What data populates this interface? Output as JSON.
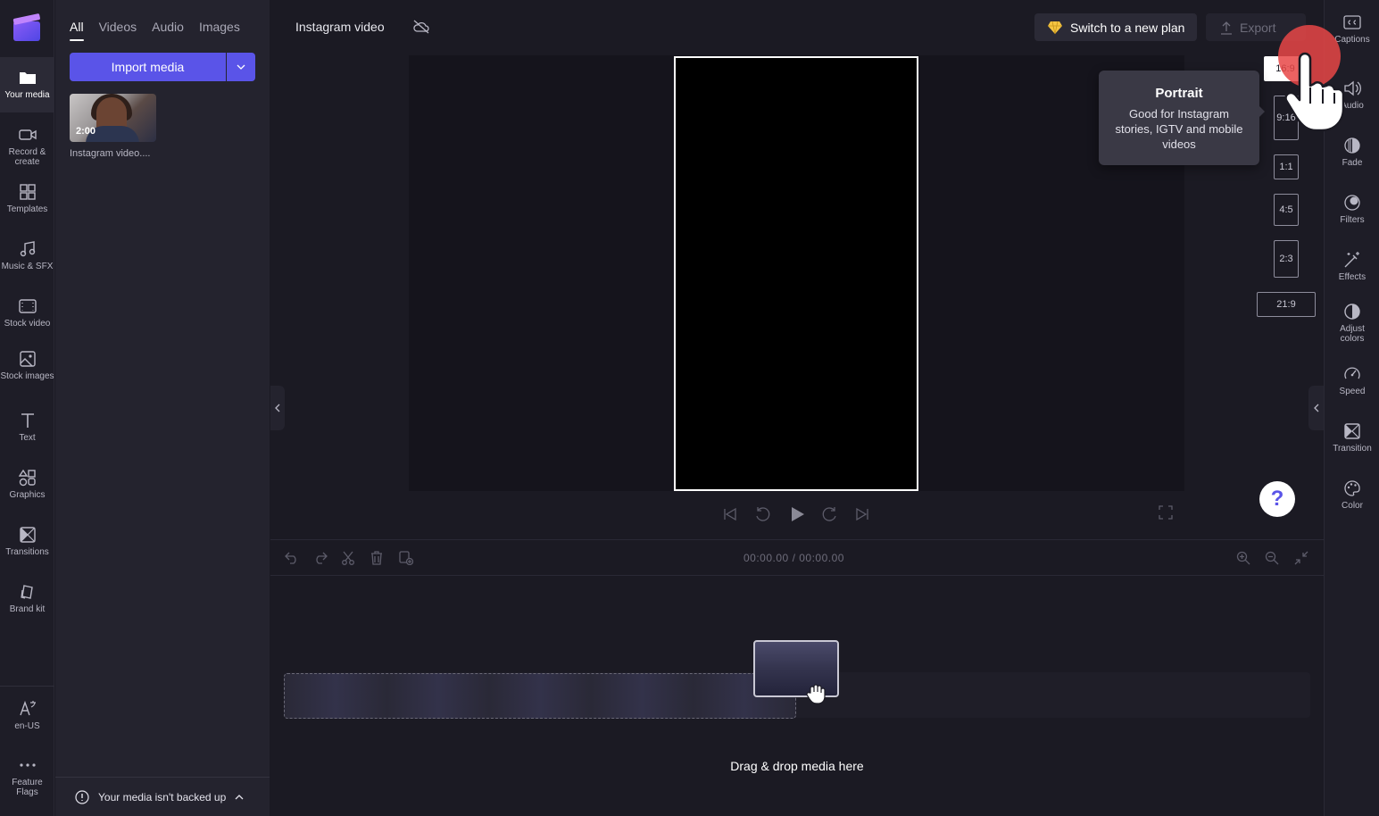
{
  "left_rail": {
    "items": [
      {
        "label": "Your media",
        "icon": "folder-icon"
      },
      {
        "label": "Record & create",
        "icon": "camera-icon"
      },
      {
        "label": "Templates",
        "icon": "templates-icon"
      },
      {
        "label": "Music & SFX",
        "icon": "music-icon"
      },
      {
        "label": "Stock video",
        "icon": "film-icon"
      },
      {
        "label": "Stock images",
        "icon": "image-icon"
      },
      {
        "label": "Text",
        "icon": "text-icon"
      },
      {
        "label": "Graphics",
        "icon": "shapes-icon"
      },
      {
        "label": "Transitions",
        "icon": "transitions-icon"
      },
      {
        "label": "Brand kit",
        "icon": "brand-kit-icon"
      }
    ],
    "language": "en-US",
    "feature_flags": "Feature Flags"
  },
  "media_panel": {
    "tabs": [
      "All",
      "Videos",
      "Audio",
      "Images"
    ],
    "active_tab": "All",
    "import_label": "Import media",
    "item": {
      "duration": "2:00",
      "name": "Instagram video...."
    },
    "backup_notice": "Your media isn't backed up"
  },
  "header": {
    "project_title": "Instagram video",
    "plan_button": "Switch to a new plan",
    "export_button": "Export"
  },
  "aspect_ratios": {
    "options": [
      "16:9",
      "9:16",
      "1:1",
      "4:5",
      "2:3",
      "21:9"
    ],
    "selected": "16:9"
  },
  "tooltip": {
    "title": "Portrait",
    "body": "Good for Instagram stories, IGTV and mobile videos"
  },
  "timeline": {
    "current_time": "00:00.00",
    "separator": "/",
    "total_time": "00:00.00",
    "drop_text": "Drag & drop media here"
  },
  "right_rail": {
    "items": [
      {
        "label": "Captions",
        "icon": "captions-icon"
      },
      {
        "label": "Audio",
        "icon": "speaker-icon"
      },
      {
        "label": "Fade",
        "icon": "fade-icon"
      },
      {
        "label": "Filters",
        "icon": "filters-icon"
      },
      {
        "label": "Effects",
        "icon": "magic-wand-icon"
      },
      {
        "label": "Adjust colors",
        "icon": "contrast-icon"
      },
      {
        "label": "Speed",
        "icon": "speedometer-icon"
      },
      {
        "label": "Transition",
        "icon": "transition-icon"
      },
      {
        "label": "Color",
        "icon": "palette-icon"
      }
    ]
  },
  "colors": {
    "accent": "#5a54e8",
    "background": "#1b1a23",
    "panel": "#24232e",
    "click_indicator": "#e84646"
  }
}
